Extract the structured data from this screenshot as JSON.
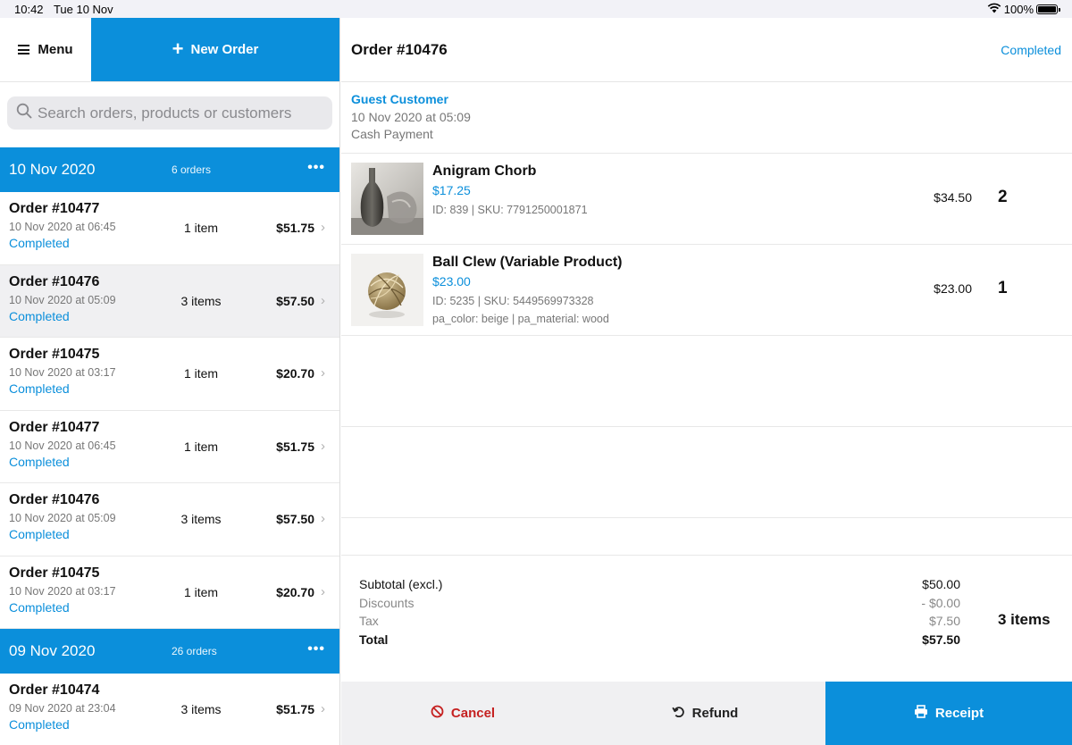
{
  "status_bar": {
    "time": "10:42",
    "date": "Tue 10 Nov",
    "battery": "100%"
  },
  "left": {
    "menu_label": "Menu",
    "new_order_label": "New Order",
    "search_placeholder": "Search orders, products or customers",
    "groups": [
      {
        "date": "10 Nov 2020",
        "count": "6 orders",
        "orders": [
          {
            "number": "Order #10477",
            "time": "10 Nov 2020 at 06:45",
            "status": "Completed",
            "items": "1 item",
            "total": "$51.75"
          },
          {
            "number": "Order #10476",
            "time": "10 Nov 2020 at 05:09",
            "status": "Completed",
            "items": "3 items",
            "total": "$57.50"
          },
          {
            "number": "Order #10475",
            "time": "10 Nov 2020 at 03:17",
            "status": "Completed",
            "items": "1 item",
            "total": "$20.70"
          },
          {
            "number": "Order #10477",
            "time": "10 Nov 2020 at 06:45",
            "status": "Completed",
            "items": "1 item",
            "total": "$51.75"
          },
          {
            "number": "Order #10476",
            "time": "10 Nov 2020 at 05:09",
            "status": "Completed",
            "items": "3 items",
            "total": "$57.50"
          },
          {
            "number": "Order #10475",
            "time": "10 Nov 2020 at 03:17",
            "status": "Completed",
            "items": "1 item",
            "total": "$20.70"
          }
        ]
      },
      {
        "date": "09 Nov 2020",
        "count": "26 orders",
        "orders": [
          {
            "number": "Order #10474",
            "time": "09 Nov 2020 at 23:04",
            "status": "Completed",
            "items": "3 items",
            "total": "$51.75"
          }
        ]
      }
    ]
  },
  "detail": {
    "title": "Order #10476",
    "status": "Completed",
    "customer": {
      "name": "Guest Customer",
      "date": "10 Nov 2020 at 05:09",
      "payment": "Cash Payment"
    },
    "items": [
      {
        "name": "Anigram Chorb",
        "price": "$17.25",
        "meta": "ID: 839 | SKU: 7791250001871",
        "attrs": "",
        "line_total": "$34.50",
        "qty": "2"
      },
      {
        "name": "Ball Clew (Variable Product)",
        "price": "$23.00",
        "meta": "ID: 5235 | SKU: 5449569973328",
        "attrs": "pa_color: beige | pa_material: wood",
        "line_total": "$23.00",
        "qty": "1"
      }
    ],
    "totals": {
      "subtotal_label": "Subtotal (excl.)",
      "subtotal": "$50.00",
      "discounts_label": "Discounts",
      "discounts": "- $0.00",
      "tax_label": "Tax",
      "tax": "$7.50",
      "total_label": "Total",
      "total": "$57.50",
      "item_count": "3 items"
    },
    "actions": {
      "cancel": "Cancel",
      "refund": "Refund",
      "receipt": "Receipt"
    }
  },
  "colors": {
    "accent": "#0b8fdb",
    "danger": "#c52121"
  }
}
